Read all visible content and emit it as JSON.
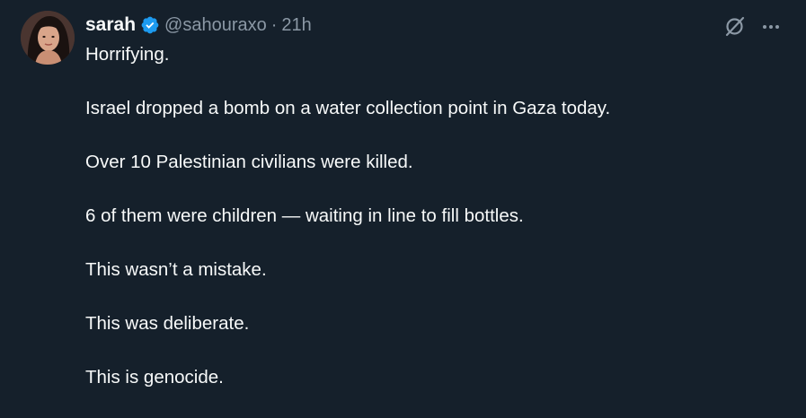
{
  "author": {
    "display_name": "sarah",
    "handle": "@sahouraxo",
    "verified": true,
    "separator": "·",
    "timestamp": "21h"
  },
  "tweet": {
    "lines": [
      "Horrifying.",
      "Israel dropped a bomb on a water collection point in Gaza today.",
      "Over 10 Palestinian civilians were killed.",
      "6 of them were children — waiting in line to fill bottles.",
      "This wasn’t a mistake.",
      "This was deliberate.",
      "This is genocide."
    ]
  },
  "icons": {
    "verified": "verified-badge-icon",
    "grok": "grok-icon",
    "more": "more-options-icon"
  },
  "colors": {
    "background": "#15202b",
    "text_primary": "#f7f9f9",
    "text_secondary": "#8b98a5",
    "verified_blue": "#1d9bf0"
  }
}
